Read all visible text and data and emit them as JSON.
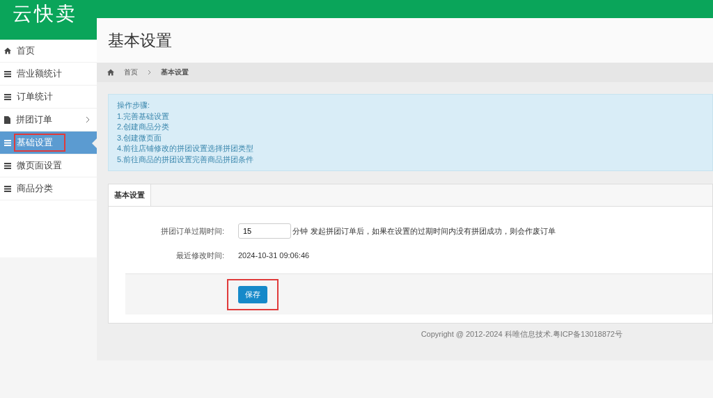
{
  "logo": "云快卖",
  "sidebar": {
    "items": [
      {
        "label": "首页",
        "kind": "home",
        "selected": false,
        "expandable": false,
        "highlighted": false
      },
      {
        "label": "营业额统计",
        "kind": "list",
        "selected": false,
        "expandable": false,
        "highlighted": false
      },
      {
        "label": "订单统计",
        "kind": "list",
        "selected": false,
        "expandable": false,
        "highlighted": false
      },
      {
        "label": "拼团订单",
        "kind": "file",
        "selected": false,
        "expandable": true,
        "highlighted": false
      },
      {
        "label": "基础设置",
        "kind": "list",
        "selected": true,
        "expandable": false,
        "highlighted": true
      },
      {
        "label": "微页面设置",
        "kind": "list",
        "selected": false,
        "expandable": false,
        "highlighted": false
      },
      {
        "label": "商品分类",
        "kind": "list",
        "selected": false,
        "expandable": false,
        "highlighted": false
      }
    ]
  },
  "page_title": "基本设置",
  "breadcrumb": [
    {
      "label": "首页"
    },
    {
      "label": "基本设置"
    }
  ],
  "notice": {
    "title": "操作步骤:",
    "steps": [
      "1.完善基础设置",
      "2.创建商品分类",
      "3.创建微页面",
      "4.前往店铺修改的拼团设置选择拼团类型",
      "5.前往商品的拼团设置完善商品拼团条件"
    ]
  },
  "tabs": [
    {
      "label": "基本设置",
      "selected": true
    }
  ],
  "form": {
    "expiry": {
      "label": "拼团订单过期时间:",
      "value": "15",
      "unit": "分钟",
      "hint": "发起拼团订单后，如果在设置的过期时间内没有拼团成功，则会作废订单"
    },
    "modified": {
      "label": "最近修改时间:",
      "value": "2024-10-31 09:06:46"
    },
    "save_button": {
      "label": "保存",
      "highlighted": true
    }
  },
  "footer": "Copyright @ 2012-2024 科唯信息技术.粤ICP备13018872号"
}
